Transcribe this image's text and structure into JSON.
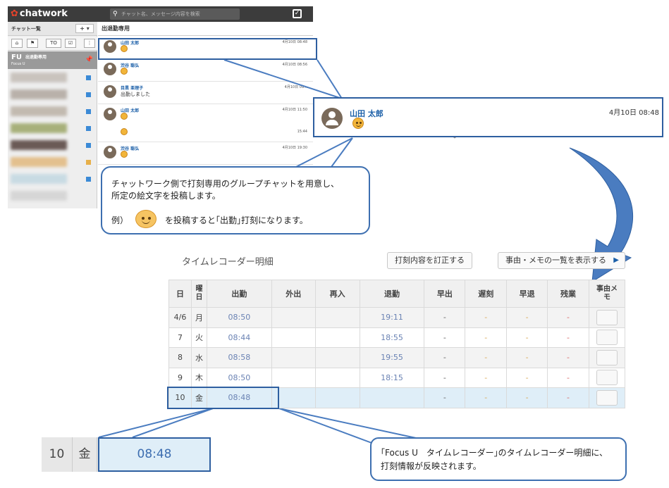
{
  "chatwork": {
    "logo": "chatwork",
    "search_placeholder": "チャット名、メッセージ内容を検索",
    "sidebar_title": "チャット一覧",
    "add_label": "+ ▾",
    "icon_buttons": [
      "⌂",
      "⚑",
      "TO",
      "☑",
      "⋮"
    ],
    "room_logo": "FU",
    "room_name": "出退勤専用",
    "room_sub": "Focus U",
    "room_title": "出退勤専用",
    "messages": [
      {
        "name": "山田 太郎",
        "time": "4月10日 08:48",
        "emoji": true
      },
      {
        "name": "渋谷 聡弘",
        "time": "4月10日 08:56",
        "emoji": true
      },
      {
        "name": "目黒 亜理子",
        "time": "4月10日 09:..",
        "text": "出勤しました"
      },
      {
        "name": "山田 太郎",
        "time": "4月10日 11:50",
        "time2": "15:44",
        "emoji": true,
        "emoji2": true
      },
      {
        "name": "渋谷 聡弘",
        "time": "4月10日 19:30",
        "emoji": true
      }
    ]
  },
  "zoom_message": {
    "name": "山田 太郎",
    "time": "4月10日 08:48"
  },
  "callout1": {
    "line1": "チャットワーク側で打刻専用のグループチャットを用意し、",
    "line2": "所定の絵文字を投稿します。",
    "example": "例）",
    "tail": "を投稿すると｢出勤｣打刻になります。"
  },
  "time_recorder": {
    "title": "タイムレコーダー明細",
    "fix_button": "打刻内容を訂正する",
    "list_button": "事由・メモの一覧を表示する",
    "list_arrow": "▶",
    "headers": [
      "日",
      "曜日",
      "出勤",
      "外出",
      "再入",
      "退勤",
      "早出",
      "遅刻",
      "早退",
      "残業",
      "事由メモ"
    ],
    "rows": [
      {
        "day": "4/6",
        "wd": "月",
        "in": "08:50",
        "out": "19:11",
        "early": "-",
        "late": "-",
        "leave": "-",
        "over": "-"
      },
      {
        "day": "7",
        "wd": "火",
        "in": "08:44",
        "out": "18:55",
        "early": "-",
        "late": "-",
        "leave": "-",
        "over": "-"
      },
      {
        "day": "8",
        "wd": "水",
        "in": "08:58",
        "out": "19:55",
        "early": "-",
        "late": "-",
        "leave": "-",
        "over": "-"
      },
      {
        "day": "9",
        "wd": "木",
        "in": "08:50",
        "out": "18:15",
        "early": "-",
        "late": "-",
        "leave": "-",
        "over": "-"
      },
      {
        "day": "10",
        "wd": "金",
        "in": "08:48",
        "out": "",
        "early": "-",
        "late": "-",
        "leave": "-",
        "over": "-"
      }
    ]
  },
  "zoom_row": {
    "day": "10",
    "wd": "金",
    "in": "08:48"
  },
  "callout2": {
    "line1": "｢Focus U　タイムレコーダー｣のタイムレコーダー明細に、",
    "line2": "打刻情報が反映されます。"
  },
  "colors": {
    "accent": "#2e5fa0",
    "arrow": "#4a7cc0",
    "selected_row": "#dfeef8"
  }
}
